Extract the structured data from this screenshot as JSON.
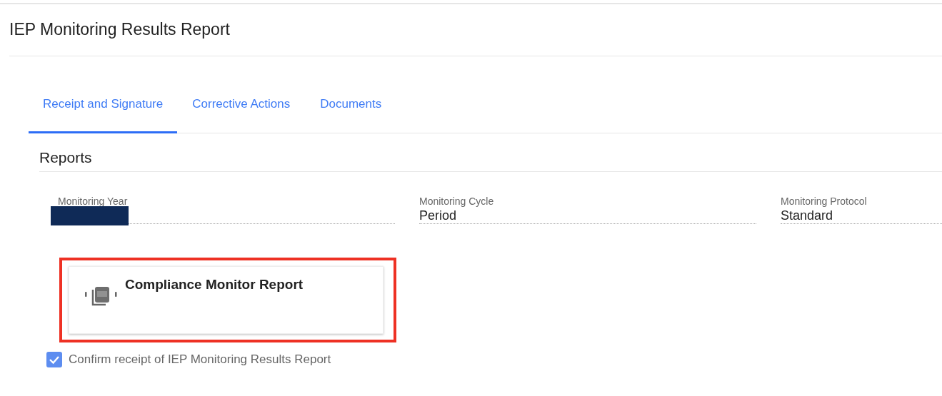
{
  "page": {
    "title": "IEP Monitoring Results Report"
  },
  "tabs": [
    {
      "label": "Receipt and Signature",
      "selected": true
    },
    {
      "label": "Corrective Actions",
      "selected": false
    },
    {
      "label": "Documents",
      "selected": false
    }
  ],
  "section": {
    "title": "Reports"
  },
  "fields": [
    {
      "label": "Monitoring Year",
      "kind": "redacted"
    },
    {
      "label": "Monitoring Cycle",
      "kind": "text",
      "value": "Period"
    },
    {
      "label": "Monitoring Protocol",
      "kind": "text",
      "value": "Standard"
    }
  ],
  "report_card": {
    "title": "Compliance Monitor Report",
    "highlighted": true
  },
  "confirm": {
    "label": "Confirm receipt of IEP Monitoring Results Report",
    "checked": true
  }
}
